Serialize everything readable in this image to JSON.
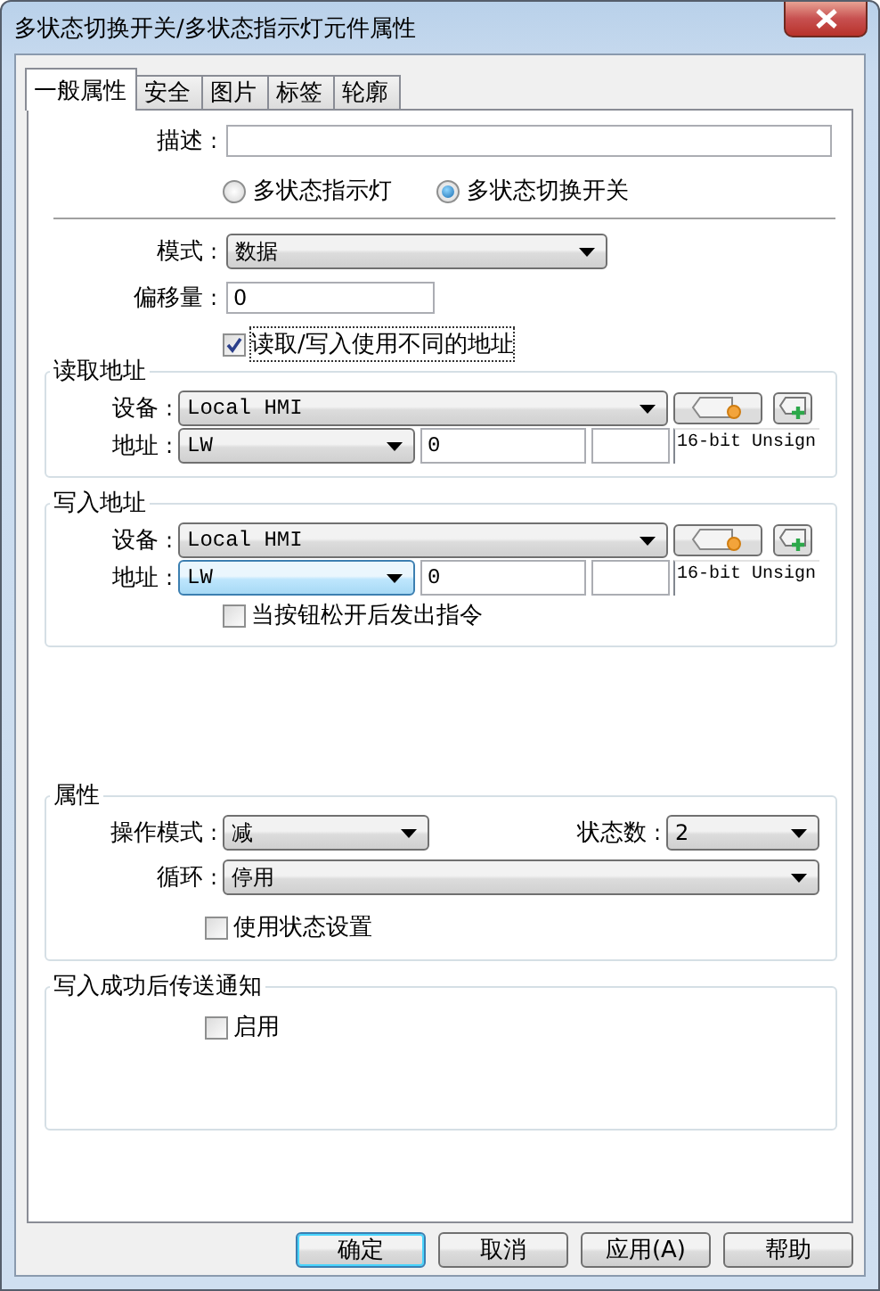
{
  "window": {
    "title": "多状态切换开关/多状态指示灯元件属性"
  },
  "tabs": [
    {
      "label": "一般属性",
      "selected": true
    },
    {
      "label": "安全",
      "selected": false
    },
    {
      "label": "图片",
      "selected": false
    },
    {
      "label": "标签",
      "selected": false
    },
    {
      "label": "轮廓",
      "selected": false
    }
  ],
  "description": {
    "label": "描述",
    "colon": ":"
  },
  "types": [
    {
      "label": "多状态指示灯",
      "selected": false
    },
    {
      "label": "多状态切换开关",
      "selected": true
    }
  ],
  "mode": {
    "label": "模式",
    "colon": ":",
    "value": "数据"
  },
  "offset": {
    "label": "偏移量",
    "colon": ":",
    "value": "0"
  },
  "separate_address": {
    "label": "读取/写入使用不同的地址",
    "checked": true
  },
  "read_address": {
    "title": "读取地址",
    "device": {
      "label": "设备",
      "colon": ":",
      "value": "Local HMI"
    },
    "address": {
      "label": "地址",
      "colon": ":",
      "type": "LW",
      "hovered": false,
      "value": "0",
      "data_type": "16-bit Unsign"
    }
  },
  "write_address": {
    "title": "写入地址",
    "device": {
      "label": "设备",
      "colon": ":",
      "value": "Local HMI"
    },
    "address": {
      "label": "地址",
      "colon": ":",
      "type": "LW",
      "hovered": true,
      "value": "0",
      "data_type": "16-bit Unsign"
    },
    "release_trigger": {
      "label": "当按钮松开后发出指令",
      "checked": false
    }
  },
  "attributes": {
    "title": "属性",
    "operation_mode": {
      "label": "操作模式",
      "colon": ":",
      "value": "减"
    },
    "state_count": {
      "label": "状态数",
      "colon": ":",
      "value": "2"
    },
    "loop": {
      "label": "循环",
      "colon": ":",
      "value": "停用"
    },
    "use_state_settings": {
      "label": "使用状态设置",
      "checked": false
    }
  },
  "notify": {
    "title": "写入成功后传送通知",
    "enable": {
      "label": "启用",
      "checked": false
    }
  },
  "buttons": [
    {
      "label": "确定",
      "default": true
    },
    {
      "label": "取消",
      "default": false
    },
    {
      "label": "应用(A)",
      "default": false
    },
    {
      "label": "帮助",
      "default": false
    }
  ]
}
